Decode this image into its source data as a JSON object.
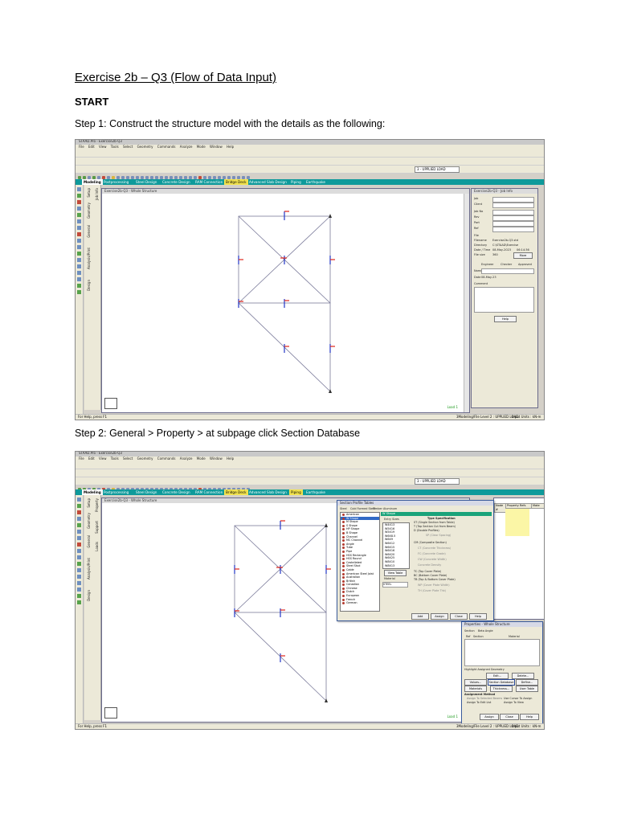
{
  "doc": {
    "title": "Exercise 2b – Q3 (Flow of Data Input)",
    "start": "START",
    "step1": "Step 1: Construct the structure model with the details as the following:",
    "step2": "Step 2: General > Property > at subpage click Section Database"
  },
  "app": {
    "window_title": "STAAD.Pro - Exercise2b-Q3",
    "menus": [
      "File",
      "Edit",
      "View",
      "Tools",
      "Select",
      "Geometry",
      "Commands",
      "Analyze",
      "Mode",
      "Window",
      "Help"
    ],
    "units_combo": "3 - UPPLIED LOAD",
    "tabs": [
      "Modeling",
      "Postprocessing",
      "Steel Design",
      "Concrete Design",
      "RAM Connection",
      "Bridge Deck",
      "Advanced Slab Design",
      "Piping",
      "Earthquake"
    ],
    "active_tab": "Modeling",
    "viewport_title": "Exercise2b-Q3 - Whole Structure",
    "load_label": "Load 1",
    "left_pages": [
      "Setup",
      "Geometry",
      "General",
      "Analysis/Print",
      "Design"
    ],
    "subpages": [
      "Job Info",
      "Property",
      "Support",
      "Loads"
    ],
    "status_left": "For Help, press F1",
    "status_mid": "3Modeling/File Level 2 : UPPLIED LOAD",
    "status_right": "Input Units : kN-m"
  },
  "job_info": {
    "title": "Exercise2b-Q3 - Job Info",
    "fields": [
      "Job",
      "Client",
      "Job No",
      "Rev",
      "Part",
      "Ref",
      "File",
      "Filename",
      "Directory",
      "Date / Time",
      "File size"
    ],
    "filename": "Exercise2b-Q3.std",
    "directory": "C:\\STAAD\\Exercise",
    "date": "08-May-2023",
    "time": "06:14:36",
    "file_size": "360",
    "more_button": "More",
    "sign_headers": [
      "Engineer",
      "Checker",
      "Approved"
    ],
    "sign_rows": [
      "Name",
      "Date"
    ],
    "date_value": "08-May-23",
    "comment_label": "Comment",
    "help_button": "Help"
  },
  "section_dialog": {
    "title": "Section Profile Tables",
    "tabs": [
      "Steel",
      "Cold Formed Steel",
      "Timber",
      "Aluminum"
    ],
    "tree": [
      "American",
      "W Shape",
      "M Shape",
      "S Shape",
      "HP Shape",
      "B Shape",
      "Channel",
      "MC Channel",
      "Angle",
      "Tube",
      "Pipe",
      "HSS Rectangle",
      "HSS Round",
      "Castellated",
      "Steel Stud",
      "Cable",
      "American Steel Joist",
      "Australian",
      "British",
      "Canadian",
      "Chinese",
      "Dutch",
      "European",
      "French",
      "German"
    ],
    "selected_group": "W Shape",
    "entry_label": "Entry Sizes",
    "sizes": [
      "W4X13",
      "W5X16",
      "W5X19",
      "W6X8.5",
      "W6X9",
      "W6X12",
      "W6X15",
      "W6X16",
      "W6X20",
      "W6X25",
      "W8X10",
      "W8X13"
    ],
    "view_table_button": "View Table",
    "material_label": "Material",
    "material_value": "STEEL",
    "type_spec_header": "Type Specification",
    "type_options": [
      "ST (Single Section from Table)",
      "T (Top Section Cut from Beam)",
      "D (Double Profiles)",
      "CM (Composite Section)",
      "TC (Top Cover Plate)",
      "BC (Bottom Cover Plate)",
      "TB (Top & Bottom Cover Plate)"
    ],
    "clear_spacing_label": "SP (Clear Spacing)",
    "composite_fields": [
      "CT (Concrete Thickness)",
      "FC (Concrete Grade)",
      "CW (Concrete Width)",
      "Concrete Density",
      "WP (Cover Plate Width)",
      "TH (Cover Plate Thk)"
    ],
    "buttons": [
      "Add",
      "Assign",
      "Close",
      "Help"
    ]
  },
  "properties_dialog": {
    "title": "Properties - Whole Structure",
    "tabs": [
      "Section",
      "Beta Angle"
    ],
    "columns": [
      "Ref",
      "Section",
      "Material"
    ],
    "highlight_label": "Highlight Assigned Geometry",
    "buttons": [
      "Edit...",
      "Delete...",
      "Values...",
      "Section Database",
      "Define...",
      "Thickness...",
      "Materials",
      "User Table"
    ],
    "assignment_header": "Assignment Method",
    "assignment_options": [
      "Assign To Selected Beams",
      "Assign To Edit List",
      "Use Cursor To Assign",
      "Assign To View"
    ],
    "footer_buttons": [
      "Assign",
      "Close",
      "Help"
    ]
  },
  "table_panel": {
    "headers": [
      "Node #",
      "Property Refs",
      "Mate"
    ]
  },
  "colors": {
    "tab_bar": "#0e9a9b",
    "highlight_tab": "#f2e34e",
    "member_line": "#7a7a9a",
    "load_red": "#e0261c",
    "load_blue": "#2136c6",
    "support": "#333333"
  }
}
